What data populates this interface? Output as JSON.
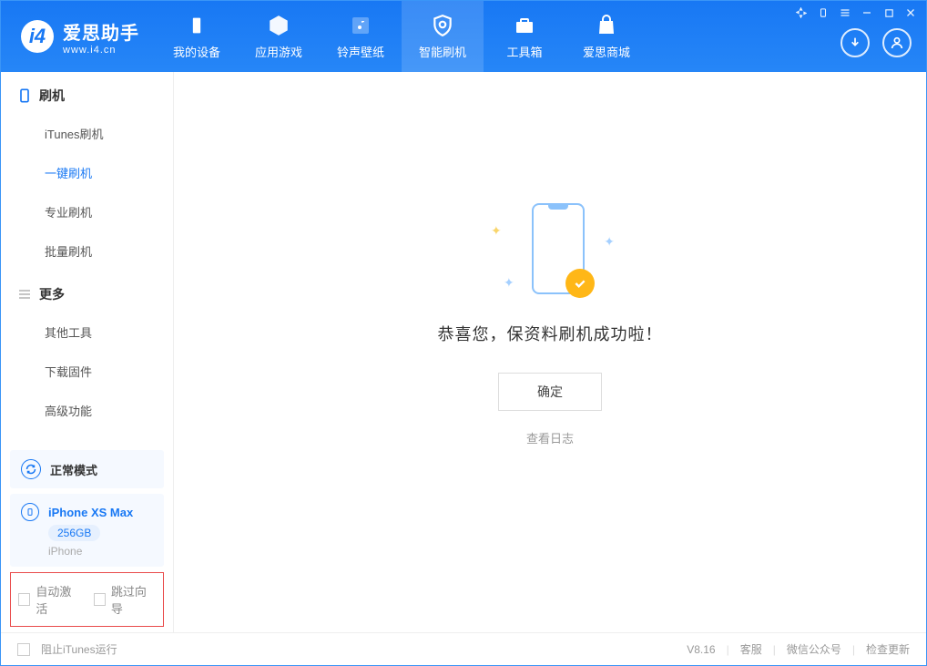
{
  "brand": {
    "name": "爱思助手",
    "url": "www.i4.cn"
  },
  "nav": [
    {
      "label": "我的设备"
    },
    {
      "label": "应用游戏"
    },
    {
      "label": "铃声壁纸"
    },
    {
      "label": "智能刷机"
    },
    {
      "label": "工具箱"
    },
    {
      "label": "爱思商城"
    }
  ],
  "sidebar": {
    "flash_hdr": "刷机",
    "flash_items": [
      {
        "label": "iTunes刷机"
      },
      {
        "label": "一键刷机"
      },
      {
        "label": "专业刷机"
      },
      {
        "label": "批量刷机"
      }
    ],
    "more_hdr": "更多",
    "more_items": [
      {
        "label": "其他工具"
      },
      {
        "label": "下载固件"
      },
      {
        "label": "高级功能"
      }
    ]
  },
  "mode": {
    "label": "正常模式"
  },
  "device": {
    "name": "iPhone XS Max",
    "capacity": "256GB",
    "type": "iPhone"
  },
  "options": {
    "auto_activate": "自动激活",
    "skip_guide": "跳过向导"
  },
  "main": {
    "success_text": "恭喜您，保资料刷机成功啦！",
    "ok": "确定",
    "log_link": "查看日志"
  },
  "footer": {
    "block_itunes": "阻止iTunes运行",
    "version": "V8.16",
    "support": "客服",
    "wechat": "微信公众号",
    "update": "检查更新"
  }
}
